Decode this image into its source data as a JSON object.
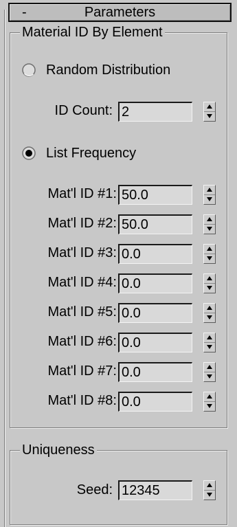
{
  "panel": {
    "collapse_symbol": "-",
    "title": "Parameters"
  },
  "material_group": {
    "legend": "Material ID By Element",
    "random_distribution": {
      "label": "Random Distribution",
      "checked": false
    },
    "id_count": {
      "label": "ID Count:",
      "value": "2"
    },
    "list_frequency": {
      "label": "List Frequency",
      "checked": true
    },
    "mat_ids": [
      {
        "label": "Mat'l ID #1:",
        "value": "50.0"
      },
      {
        "label": "Mat'l ID #2:",
        "value": "50.0"
      },
      {
        "label": "Mat'l ID #3:",
        "value": "0.0"
      },
      {
        "label": "Mat'l ID #4:",
        "value": "0.0"
      },
      {
        "label": "Mat'l ID #5:",
        "value": "0.0"
      },
      {
        "label": "Mat'l ID #6:",
        "value": "0.0"
      },
      {
        "label": "Mat'l ID #7:",
        "value": "0.0"
      },
      {
        "label": "Mat'l ID #8:",
        "value": "0.0"
      }
    ]
  },
  "uniqueness_group": {
    "legend": "Uniqueness",
    "seed": {
      "label": "Seed:",
      "value": "12345"
    }
  },
  "colors": {
    "panel_bg": "#c8c8c8",
    "field_bg": "#d9d9d9"
  }
}
